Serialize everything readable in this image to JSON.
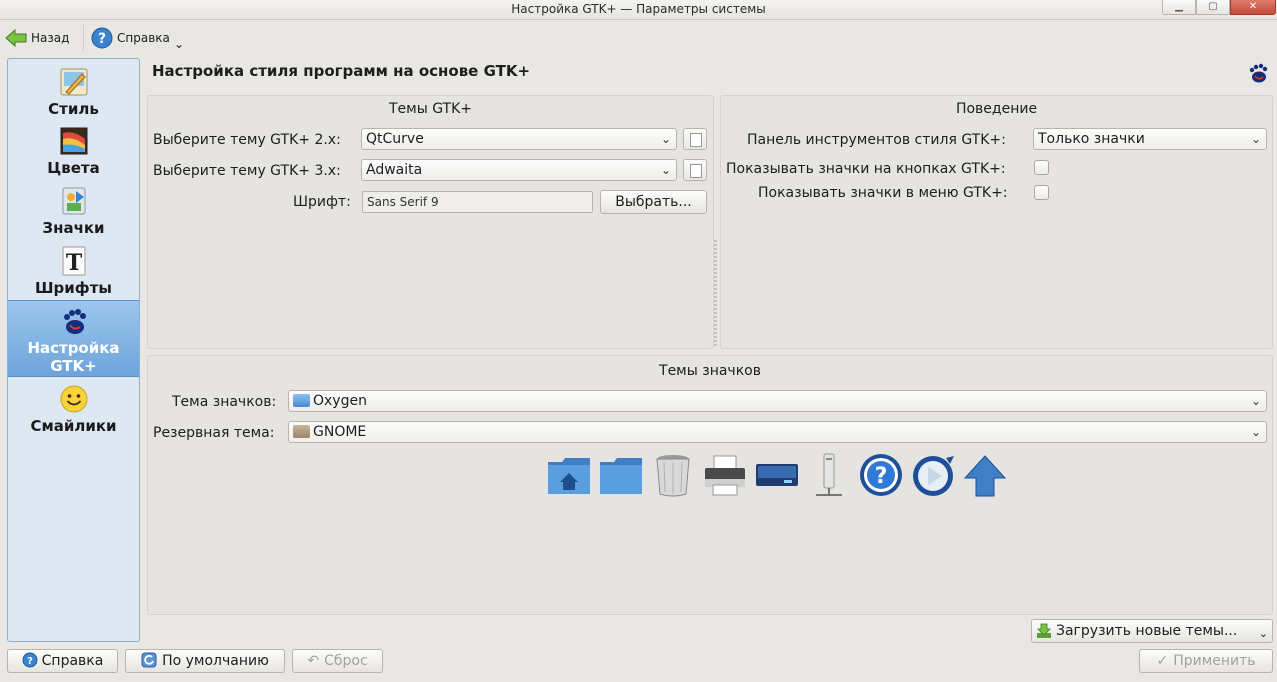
{
  "window": {
    "title": "Настройка GTK+ — Параметры системы",
    "controls": {
      "minimize": "▁",
      "maximize": "▢",
      "close": "✕"
    }
  },
  "toolbar": {
    "back_label": "Назад",
    "help_label": "Справка",
    "help_menu_arrow": "⌄"
  },
  "sidebar": {
    "items": [
      {
        "label": "Стиль",
        "icon": "style-icon"
      },
      {
        "label": "Цвета",
        "icon": "colors-icon"
      },
      {
        "label": "Значки",
        "icon": "icons-icon"
      },
      {
        "label": "Шрифты",
        "icon": "fonts-icon"
      },
      {
        "label": "Настройка GTK+",
        "icon": "gnome-foot-icon",
        "active": true
      },
      {
        "label": "Смайлики",
        "icon": "smiley-icon"
      }
    ]
  },
  "page": {
    "title": "Настройка стиля программ на основе GTK+"
  },
  "gtk_themes": {
    "title": "Темы GTK+",
    "gtk2_label": "Выберите тему GTK+ 2.x:",
    "gtk2_value": "QtCurve",
    "gtk3_label": "Выберите тему GTK+ 3.x:",
    "gtk3_value": "Adwaita",
    "font_label": "Шрифт:",
    "font_value": "Sans Serif 9",
    "font_button": "Выбрать..."
  },
  "behavior": {
    "title": "Поведение",
    "toolbar_style_label": "Панель инструментов стиля GTK+:",
    "toolbar_style_value": "Только значки",
    "icons_on_buttons_label": "Показывать значки на кнопках GTK+:",
    "icons_on_buttons_checked": false,
    "icons_in_menus_label": "Показывать значки в меню GTK+:",
    "icons_in_menus_checked": false
  },
  "icon_themes": {
    "title": "Темы значков",
    "theme_label": "Тема значков:",
    "theme_value": "Oxygen",
    "fallback_label": "Резервная тема:",
    "fallback_value": "GNOME",
    "preview_icons": [
      "home-folder-icon",
      "folder-icon",
      "trash-icon",
      "printer-icon",
      "drive-icon",
      "network-server-icon",
      "help-icon",
      "media-play-icon",
      "go-up-icon"
    ],
    "download_button": "Загрузить новые темы...",
    "download_arrow": "⌄"
  },
  "footer": {
    "help_button": "Справка",
    "defaults_button": "По умолчанию",
    "reset_button": "Сброс",
    "apply_button": "Применить"
  },
  "colors": {
    "sidebar_bg": "#dde8f3",
    "sidebar_active": "#6ea4db",
    "window_bg": "#e9e7e3"
  }
}
